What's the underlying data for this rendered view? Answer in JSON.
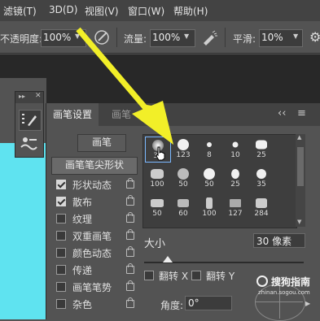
{
  "menubar": {
    "items": [
      "滤镜(T)",
      "3D(D)",
      "视图(V)",
      "窗口(W)",
      "帮助(H)"
    ]
  },
  "options": {
    "opacity_label": "不透明度:",
    "opacity_value": "100%",
    "flow_label": "流量:",
    "flow_value": "100%",
    "smooth_label": "平滑:",
    "smooth_value": "10%"
  },
  "panel": {
    "tab_active": "画笔设置",
    "tab_inactive": "画笔",
    "collapse_glyph": "‹‹",
    "menu_glyph": "≡",
    "brush_button": "画笔",
    "tip_shape_button": "画笔笔尖形状",
    "items": [
      {
        "label": "形状动态",
        "checked": true
      },
      {
        "label": "散布",
        "checked": true
      },
      {
        "label": "纹理",
        "checked": false
      },
      {
        "label": "双重画笔",
        "checked": false
      },
      {
        "label": "颜色动态",
        "checked": false
      },
      {
        "label": "传递",
        "checked": false
      },
      {
        "label": "画笔笔势",
        "checked": false
      },
      {
        "label": "杂色",
        "checked": false
      }
    ],
    "tip_sizes": [
      "30",
      "123",
      "8",
      "10",
      "25",
      "100",
      "50",
      "50",
      "25",
      "35",
      "50",
      "60",
      "100",
      "127",
      "284"
    ],
    "size_label": "大小",
    "size_value": "30 像素",
    "flip_x_label": "翻转 X",
    "flip_y_label": "翻转 Y",
    "angle_label": "角度:",
    "angle_value": "0°",
    "watermark_text": "搜狗指南",
    "watermark_url": "zhinan.sogou.com"
  },
  "colors": {
    "accent_arrow": "#f2ef28",
    "cyan_canvas": "#5fe3f0"
  }
}
